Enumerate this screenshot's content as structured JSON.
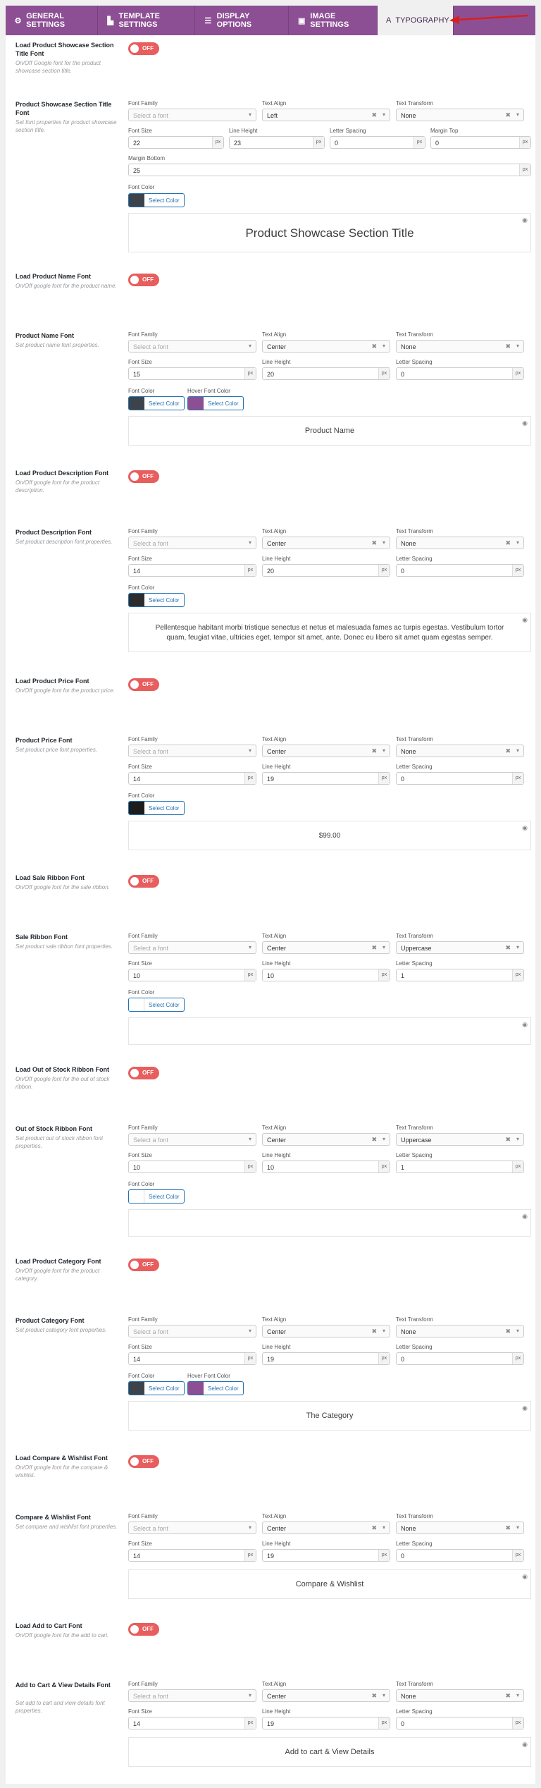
{
  "tabs": [
    {
      "label": "GENERAL SETTINGS",
      "icon": "gear-icon",
      "glyph": "⚙",
      "active": false
    },
    {
      "label": "TEMPLATE SETTINGS",
      "icon": "template-icon",
      "glyph": "▙",
      "active": false
    },
    {
      "label": "DISPLAY OPTIONS",
      "icon": "list-icon",
      "glyph": "☰",
      "active": false
    },
    {
      "label": "IMAGE SETTINGS",
      "icon": "image-icon",
      "glyph": "▣",
      "active": false
    },
    {
      "label": "TYPOGRAPHY",
      "icon": "typography-icon",
      "glyph": "A",
      "active": true
    }
  ],
  "labels": {
    "font_family": "Font Family",
    "text_align": "Text Align",
    "text_transform": "Text Transform",
    "font_size": "Font Size",
    "line_height": "Line Height",
    "letter_spacing": "Letter Spacing",
    "margin_top": "Margin Top",
    "margin_bottom": "Margin Bottom",
    "font_color": "Font Color",
    "hover_font_color": "Hover Font Color",
    "select_color": "Select Color",
    "select_font": "Select a font",
    "unit": "px",
    "toggle": "OFF",
    "clear": "✖",
    "caret": "▾",
    "eye": "◉"
  },
  "colors": {
    "toggle_off": "#e85d5d",
    "tab_bg": "#8d4f94",
    "accent_link": "#2271b1"
  },
  "sections": [
    {
      "key": "title",
      "load_label": "Load Product Showcase Section Title Font",
      "load_desc": "On/Off Google font for the product showcase section title.",
      "label": "Product Showcase Section Title Font",
      "desc": "Set font properties for product showcase section title.",
      "font_family": "",
      "text_align": "Left",
      "text_transform": "None",
      "font_size": "22",
      "line_height": "23",
      "letter_spacing": "0",
      "margin_top": "0",
      "margin_bottom": "25",
      "font_color": "#3c434a",
      "preview": "Product Showcase Section Title"
    },
    {
      "key": "name",
      "load_label": "Load Product Name Font",
      "load_desc": "On/Off google font for the product name.",
      "label": "Product Name Font",
      "desc": "Set product name font properties.",
      "font_family": "",
      "text_align": "Center",
      "text_transform": "None",
      "font_size": "15",
      "line_height": "20",
      "letter_spacing": "0",
      "font_color": "#3c434a",
      "hover_color": "#8d4f94",
      "preview": "Product Name"
    },
    {
      "key": "desc",
      "load_label": "Load Product Description Font",
      "load_desc": "On/Off google font for the product description.",
      "label": "Product Description Font",
      "desc": "Set product description font properties.",
      "font_family": "",
      "text_align": "Center",
      "text_transform": "None",
      "font_size": "14",
      "line_height": "20",
      "letter_spacing": "0",
      "font_color": "#2d2d2d",
      "preview": "Pellentesque habitant morbi tristique senectus et netus et malesuada fames ac turpis egestas. Vestibulum tortor quam, feugiat vitae, ultricies eget, tempor sit amet, ante. Donec eu libero sit amet quam egestas semper."
    },
    {
      "key": "price",
      "load_label": "Load Product Price Font",
      "load_desc": "On/Off google font for the product price.",
      "label": "Product Price Font",
      "desc": "Set product price font properties.",
      "font_family": "",
      "text_align": "Center",
      "text_transform": "None",
      "font_size": "14",
      "line_height": "19",
      "letter_spacing": "0",
      "font_color": "#1d1d1d",
      "preview": "$99.00"
    },
    {
      "key": "sale",
      "load_label": "Load Sale Ribbon Font",
      "load_desc": "On/Off google font for the sale ribbon.",
      "label": "Sale Ribbon Font",
      "desc": "Set product sale ribbon font properties.",
      "font_family": "",
      "text_align": "Center",
      "text_transform": "Uppercase",
      "font_size": "10",
      "line_height": "10",
      "letter_spacing": "1",
      "font_color": "#ffffff",
      "preview": ""
    },
    {
      "key": "oos",
      "load_label": "Load Out of Stock Ribbon Font",
      "load_desc": "On/Off google font for the out of stock ribbon.",
      "label": "Out of Stock Ribbon Font",
      "desc": "Set product out of stock ribbon font properties.",
      "font_family": "",
      "text_align": "Center",
      "text_transform": "Uppercase",
      "font_size": "10",
      "line_height": "10",
      "letter_spacing": "1",
      "font_color": "#ffffff",
      "preview": ""
    },
    {
      "key": "cat",
      "load_label": "Load Product Category Font",
      "load_desc": "On/Off google font for the product category.",
      "label": "Product Category Font",
      "desc": "Set product category font properties.",
      "font_family": "",
      "text_align": "Center",
      "text_transform": "None",
      "font_size": "14",
      "line_height": "19",
      "letter_spacing": "0",
      "font_color": "#3c434a",
      "hover_color": "#8d4f94",
      "preview": "The Category"
    },
    {
      "key": "cw",
      "load_label": "Load Compare & Wishlist Font",
      "load_desc": "On/Off google font for the compare & wishlist.",
      "label": "Compare & Wishlist Font",
      "desc": "Set compare and wishlist font properties.",
      "font_family": "",
      "text_align": "Center",
      "text_transform": "None",
      "font_size": "14",
      "line_height": "19",
      "letter_spacing": "0",
      "preview": "Compare & Wishlist"
    },
    {
      "key": "cart",
      "load_label": "Load Add to Cart Font",
      "load_desc": "On/Off google font for the add to cart.",
      "label": "Add to Cart & View Details Font",
      "desc": "Set add to cart and view details font properties.",
      "font_family": "",
      "text_align": "Center",
      "text_transform": "None",
      "font_size": "14",
      "line_height": "19",
      "letter_spacing": "0",
      "preview": "Add to cart & View Details"
    }
  ]
}
